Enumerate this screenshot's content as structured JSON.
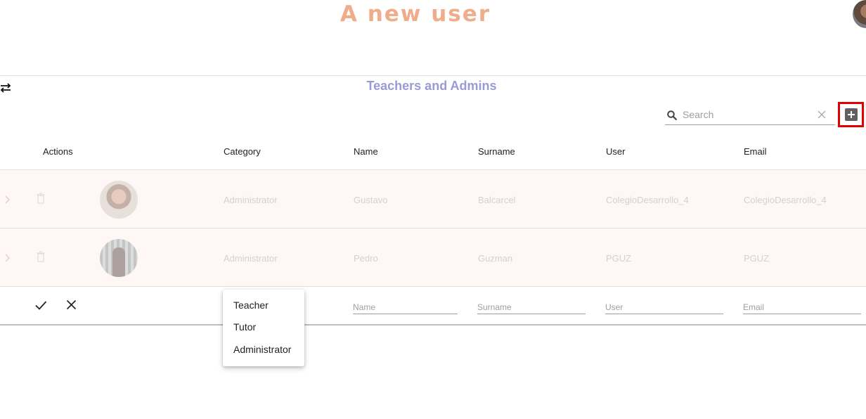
{
  "page": {
    "title": "A new user"
  },
  "table": {
    "title": "Teachers and Admins",
    "search": {
      "placeholder": "Search",
      "value": ""
    },
    "columns": {
      "actions": "Actions",
      "category": "Category",
      "name": "Name",
      "surname": "Surname",
      "user": "User",
      "email": "Email"
    },
    "rows": [
      {
        "category": "Administrator",
        "name": "Gustavo",
        "surname": "Balcarcel",
        "user": "ColegioDesarrollo_4",
        "email": "ColegioDesarrollo_4"
      },
      {
        "category": "Administrator",
        "name": "Pedro",
        "surname": "Guzman",
        "user": "PGUZ",
        "email": "PGUZ"
      }
    ],
    "new_row": {
      "name_placeholder": "Name",
      "surname_placeholder": "Surname",
      "user_placeholder": "User",
      "email_placeholder": "Email"
    },
    "category_options": [
      "Teacher",
      "Tutor",
      "Administrator"
    ]
  },
  "icons": {
    "swap": "swap-horizontal-icon",
    "search": "search-icon",
    "clear": "close-icon",
    "add": "add-box-icon",
    "expand": "chevron-right-icon",
    "delete": "trash-icon",
    "confirm": "check-icon",
    "cancel": "close-icon"
  },
  "colors": {
    "title": "#f0ad8c",
    "table_title": "#9a9ad6",
    "row_background": "#fff6f6",
    "highlight_border": "#e00000"
  }
}
